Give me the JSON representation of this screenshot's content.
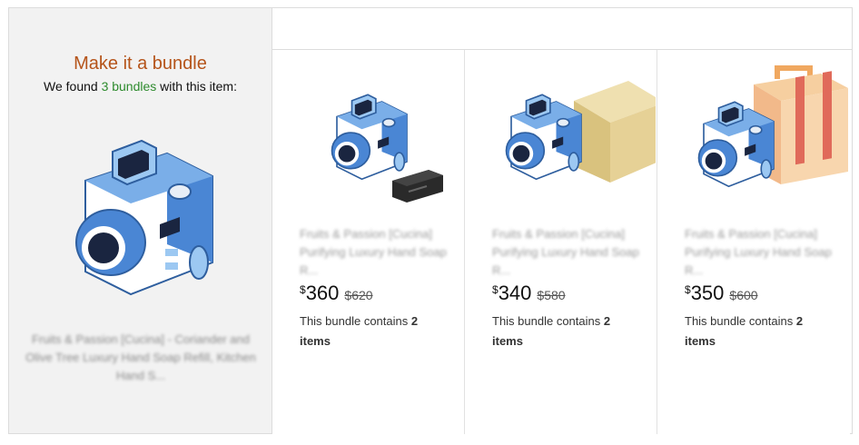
{
  "panel": {
    "title": "Make it a bundle",
    "subtitle_prefix": "We found ",
    "subtitle_count": "3 bundles",
    "subtitle_suffix": " with this item:",
    "product_title": "Fruits & Passion [Cucina] - Coriander and Olive Tree Luxury Hand Soap Refill, Kitchen Hand S..."
  },
  "bundles": [
    {
      "title": "Fruits & Passion [Cucina] Purifying Luxury Hand Soap R...",
      "currency": "$",
      "price": "360",
      "old_price": "$620",
      "contains_text": "This bundle contains ",
      "contains_count": "2",
      "contains_unit": "items",
      "extra_item_icon": "battery-icon"
    },
    {
      "title": "Fruits & Passion [Cucina] Purifying Luxury Hand Soap R...",
      "currency": "$",
      "price": "340",
      "old_price": "$580",
      "contains_text": "This bundle contains ",
      "contains_count": "2",
      "contains_unit": "items",
      "extra_item_icon": "box-icon"
    },
    {
      "title": "Fruits & Passion [Cucina] Purifying Luxury Hand Soap R...",
      "currency": "$",
      "price": "350",
      "old_price": "$600",
      "contains_text": "This bundle contains ",
      "contains_count": "2",
      "contains_unit": "items",
      "extra_item_icon": "suitcase-icon"
    }
  ],
  "colors": {
    "title_orange": "#b5541a",
    "count_green": "#2e8b2e",
    "camera_blue": "#4a86d4"
  }
}
